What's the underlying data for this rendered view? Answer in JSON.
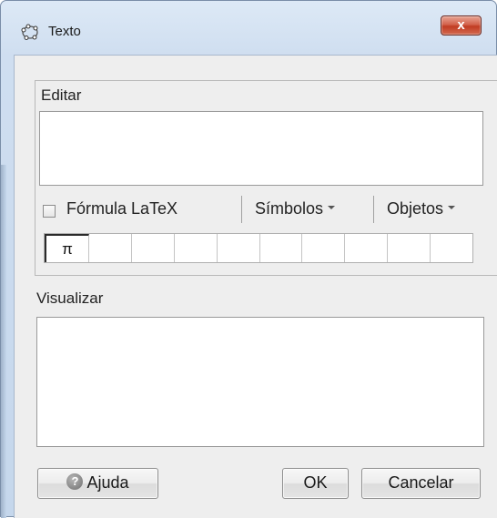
{
  "window": {
    "title": "Texto",
    "close_glyph": "x",
    "icon": "geogebra-icon"
  },
  "edit": {
    "section_label": "Editar",
    "text_value": "",
    "latex_checkbox_label": "Fórmula LaTeX",
    "latex_checked": false,
    "symbols_label": "Símbolos",
    "objects_label": "Objetos",
    "symbols": [
      "π",
      "",
      "",
      "",
      "",
      "",
      "",
      "",
      "",
      ""
    ]
  },
  "preview": {
    "section_label": "Visualizar"
  },
  "buttons": {
    "help_label": "Ajuda",
    "ok_label": "OK",
    "cancel_label": "Cancelar"
  }
}
